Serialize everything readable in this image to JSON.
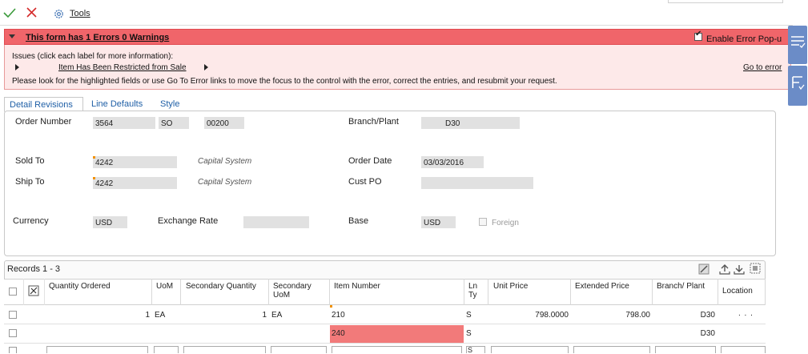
{
  "toolbar": {
    "tools_label": "Tools"
  },
  "error_banner": {
    "title": "This form has 1 Errors 0 Warnings",
    "enable_popup_label": "Enable Error Pop-u",
    "issues_label": "Issues (click each label for more information):",
    "issue_item": "Item Has Been Restricted from Sale",
    "goto_error": "Go to error",
    "message": "Please look for the highlighted fields or use Go To Error links to move the focus to the control with the error, correct the entries, and resubmit your request."
  },
  "tabs": [
    "Detail Revisions",
    "Line Defaults",
    "Style"
  ],
  "form": {
    "order_number_label": "Order Number",
    "order_number": "3564",
    "order_type": "SO",
    "order_company": "00200",
    "branch_plant_label": "Branch/Plant",
    "branch_plant": "D30",
    "sold_to_label": "Sold To",
    "sold_to": "4242",
    "sold_to_name": "Capital System",
    "order_date_label": "Order Date",
    "order_date": "03/03/2016",
    "ship_to_label": "Ship To",
    "ship_to": "4242",
    "ship_to_name": "Capital System",
    "cust_po_label": "Cust PO",
    "cust_po": "",
    "currency_label": "Currency",
    "currency": "USD",
    "exchange_rate_label": "Exchange Rate",
    "exchange_rate": "",
    "base_label": "Base",
    "base": "USD",
    "foreign_label": "Foreign"
  },
  "grid": {
    "records_label": "Records 1 - 3",
    "headers": {
      "qty_ordered": "Quantity Ordered",
      "uom": "UoM",
      "secondary_qty": "Secondary Quantity",
      "secondary_uom": "Secondary UoM",
      "item_number": "Item Number",
      "ln_ty": "Ln Ty",
      "unit_price": "Unit Price",
      "extended_price": "Extended Price",
      "branch_plant": "Branch/ Plant",
      "location": "Location"
    },
    "rows": [
      {
        "qty": "1",
        "uom": "EA",
        "sec_qty": "1",
        "sec_uom": "EA",
        "item": "210",
        "ln_ty": "S",
        "unit_price": "798.0000",
        "ext_price": "798.00",
        "branch": "D30",
        "location": ". . ."
      },
      {
        "qty": "",
        "uom": "",
        "sec_qty": "",
        "sec_uom": "",
        "item": "240",
        "ln_ty": "S",
        "unit_price": "",
        "ext_price": "",
        "branch": "D30",
        "location": ""
      },
      {
        "qty": "",
        "uom": "",
        "sec_qty": "",
        "sec_uom": "",
        "item": "",
        "ln_ty": "S",
        "unit_price": "",
        "ext_price": "",
        "branch": "",
        "location": ""
      }
    ]
  },
  "colors": {
    "error_header": "#f0656a",
    "error_body": "#fde9e9",
    "error_cell": "#f27a7a",
    "link_blue": "#1f5fa6",
    "side_panel": "#6b8cc7"
  }
}
